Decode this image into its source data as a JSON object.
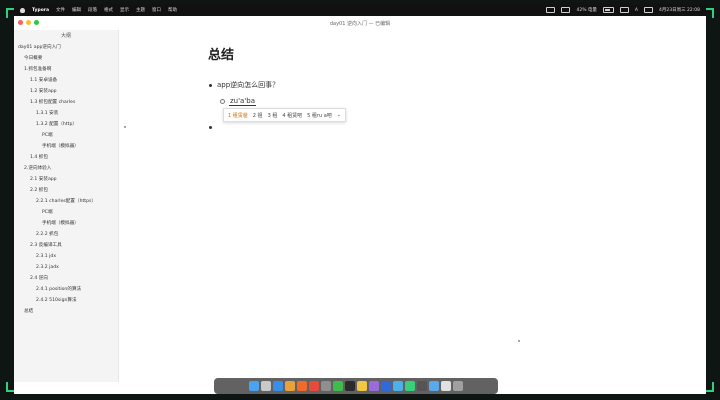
{
  "menubar": {
    "app_name": "Typora",
    "menus": [
      "文件",
      "编辑",
      "段落",
      "格式",
      "显示",
      "主题",
      "窗口",
      "帮助"
    ],
    "status_items": [
      "42% 电量",
      "A"
    ],
    "clock": "4月23日周三 22:08"
  },
  "window": {
    "title": "day01 逆向入门 — 已编辑"
  },
  "sidebar": {
    "title": "大纲",
    "toc": [
      {
        "label": "day01 app逆向入门",
        "level": 0
      },
      {
        "label": "今日概要",
        "level": 1
      },
      {
        "label": "1.抓包准备啊",
        "level": 1
      },
      {
        "label": "1.1 安卓设备",
        "level": 2
      },
      {
        "label": "1.2 安装app",
        "level": 2
      },
      {
        "label": "1.3 抓包配置 charles",
        "level": 2
      },
      {
        "label": "1.3.1 安装",
        "level": 3
      },
      {
        "label": "1.3.2 配置（http）",
        "level": 3
      },
      {
        "label": "PC端",
        "level": 4
      },
      {
        "label": "手机端（模拟器）",
        "level": 4
      },
      {
        "label": "1.4 抓包",
        "level": 2
      },
      {
        "label": "2.逆向体验入",
        "level": 1
      },
      {
        "label": "2.1 安装app",
        "level": 2
      },
      {
        "label": "2.2 抓包",
        "level": 2
      },
      {
        "label": "2.2.1 charles配置（https）",
        "level": 3
      },
      {
        "label": "PC端",
        "level": 4
      },
      {
        "label": "手机端（模拟器）",
        "level": 4
      },
      {
        "label": "2.2.2 抓包",
        "level": 3
      },
      {
        "label": "2.3 反编译工具",
        "level": 2
      },
      {
        "label": "2.3.1 jdx",
        "level": 3
      },
      {
        "label": "2.3.2 jadx",
        "level": 3
      },
      {
        "label": "2.4 逆向",
        "level": 2
      },
      {
        "label": "2.4.1 position的算法",
        "level": 3
      },
      {
        "label": "2.4.2 510sign算法",
        "level": 3
      },
      {
        "label": "总结",
        "level": 1
      }
    ]
  },
  "editor": {
    "heading": "总结",
    "bullet1": "app逆向怎么回事？",
    "ime_input": "zu'a'ba",
    "ime_candidates": [
      "1 租赁爸",
      "2 祖",
      "3 租",
      "4 租赁吧",
      "5 租ru a吧"
    ],
    "ime_expand": "⌄"
  },
  "dock": {
    "icon_names": [
      "finder-icon",
      "launchpad-icon",
      "safari-icon",
      "chrome-icon",
      "firefox-icon",
      "calendar-icon",
      "app-icon",
      "wechat-icon",
      "terminal-icon",
      "notes-icon",
      "editor-icon",
      "word-icon",
      "qq-icon",
      "pycharm-icon",
      "typora-icon",
      "cloud-icon",
      "preview-icon",
      "trash-icon"
    ]
  },
  "colors": {
    "accent": "#2ed27a",
    "ime_selected": "#d06a00"
  }
}
